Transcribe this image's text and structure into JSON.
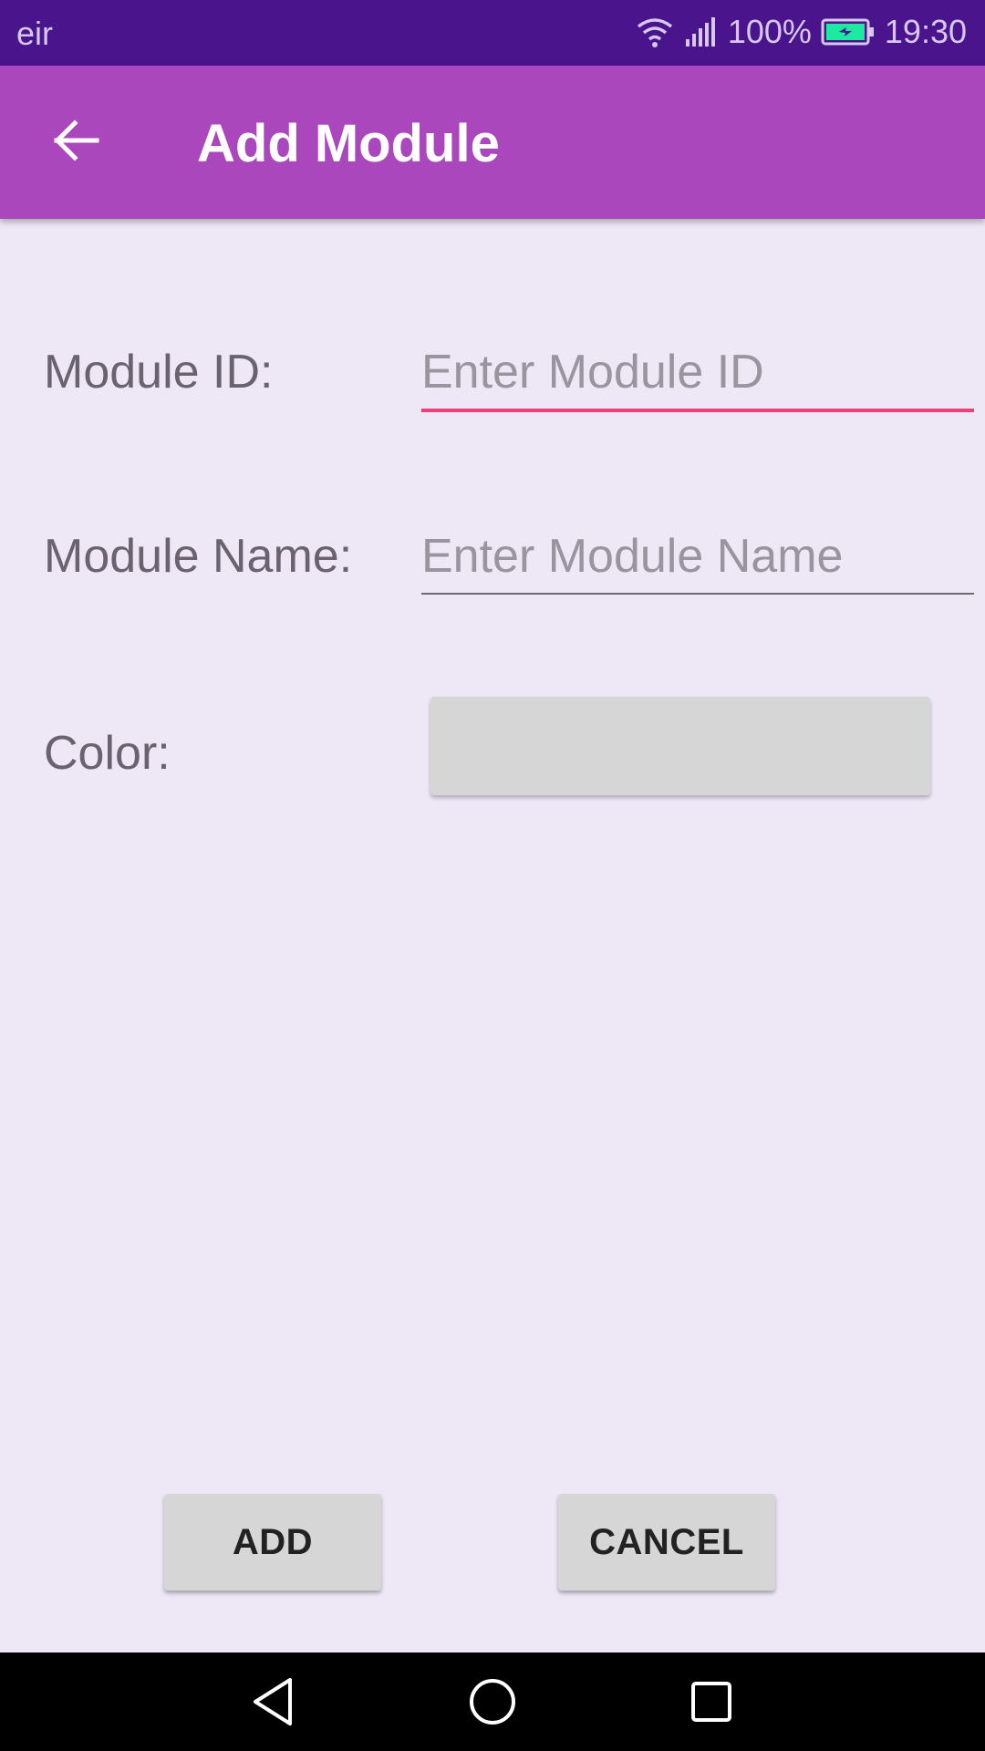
{
  "status_bar": {
    "carrier": "eir",
    "battery": "100%",
    "time": "19:30",
    "icons": [
      "wifi-icon",
      "signal-icon",
      "battery-charging-icon"
    ]
  },
  "app_bar": {
    "title": "Add Module",
    "back_icon": "arrow-back-icon",
    "color": "#ab47bc"
  },
  "form": {
    "module_id": {
      "label": "Module ID:",
      "placeholder": "Enter Module ID",
      "value": ""
    },
    "module_name": {
      "label": "Module Name:",
      "placeholder": "Enter Module Name",
      "value": ""
    },
    "color": {
      "label": "Color:",
      "swatch": "#d6d6d6"
    }
  },
  "actions": {
    "add_label": "ADD",
    "cancel_label": "CANCEL"
  },
  "nav_bar": {
    "icons": [
      "nav-back-icon",
      "nav-home-icon",
      "nav-recents-icon"
    ]
  },
  "colors": {
    "status_bar": "#4a148c",
    "accent": "#f0407c",
    "background": "#ede7f6"
  }
}
